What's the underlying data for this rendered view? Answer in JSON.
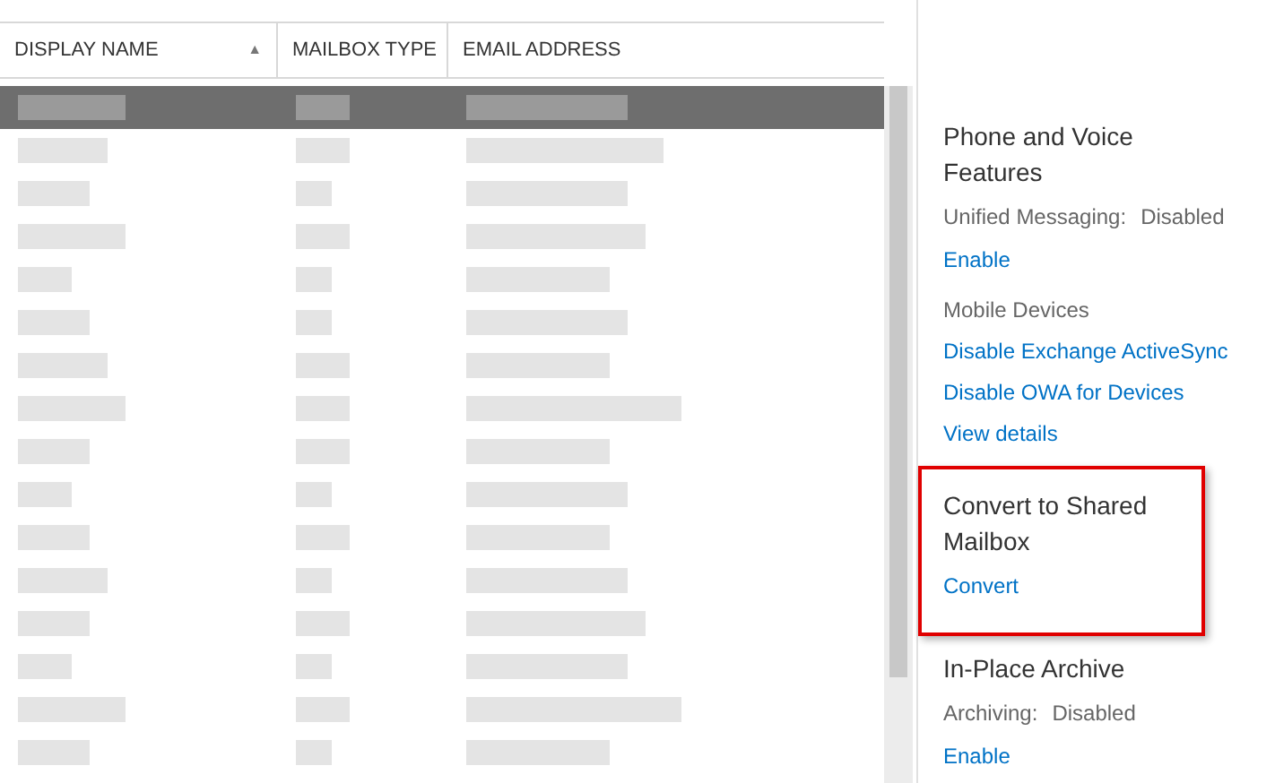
{
  "table": {
    "columns": [
      {
        "label": "DISPLAY NAME",
        "sort_indicator": "▲"
      },
      {
        "label": "MAILBOX TYPE"
      },
      {
        "label": "EMAIL ADDRESS"
      }
    ],
    "rows": [
      {
        "selected": true
      },
      {
        "selected": false
      },
      {
        "selected": false
      },
      {
        "selected": false
      },
      {
        "selected": false
      },
      {
        "selected": false
      },
      {
        "selected": false
      },
      {
        "selected": false
      },
      {
        "selected": false
      },
      {
        "selected": false
      },
      {
        "selected": false
      },
      {
        "selected": false
      },
      {
        "selected": false
      },
      {
        "selected": false
      },
      {
        "selected": false
      },
      {
        "selected": false
      }
    ]
  },
  "details": {
    "sections": [
      {
        "title": "Phone and Voice Features",
        "highlighted": false,
        "items": [
          {
            "kind": "status",
            "label": "Unified Messaging:",
            "value": "Disabled"
          },
          {
            "kind": "link",
            "text": "Enable"
          },
          {
            "kind": "heading",
            "text": "Mobile Devices"
          },
          {
            "kind": "link",
            "text": "Disable Exchange ActiveSync"
          },
          {
            "kind": "link",
            "text": "Disable OWA for Devices"
          },
          {
            "kind": "link",
            "text": "View details"
          }
        ]
      },
      {
        "title": "Convert to Shared Mailbox",
        "highlighted": true,
        "items": [
          {
            "kind": "link",
            "text": "Convert"
          }
        ]
      },
      {
        "title": "In-Place Archive",
        "highlighted": false,
        "items": [
          {
            "kind": "status",
            "label": "Archiving:",
            "value": "Disabled"
          },
          {
            "kind": "link",
            "text": "Enable"
          }
        ]
      }
    ]
  }
}
